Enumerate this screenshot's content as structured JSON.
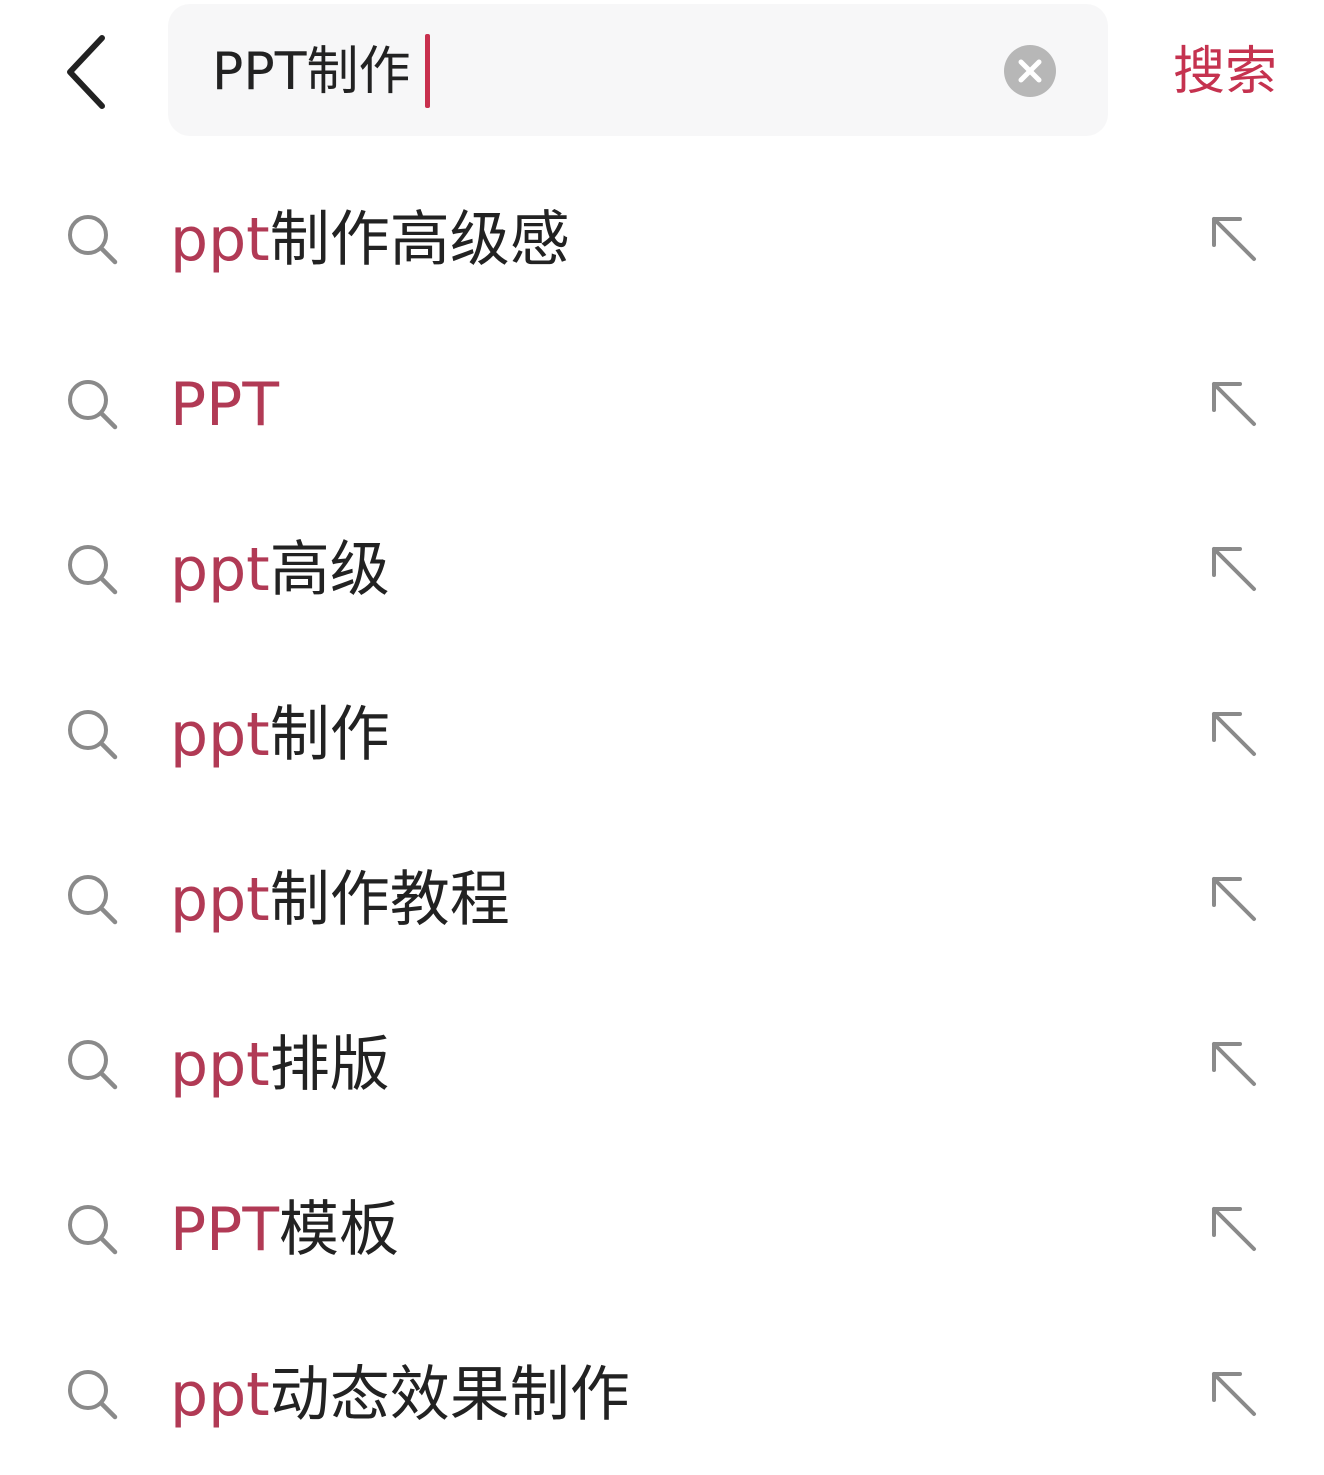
{
  "header": {
    "back_icon": "chevron-left-icon",
    "search_value": "PPT制作",
    "clear_icon": "clear-circle-icon",
    "search_button_label": "搜索"
  },
  "colors": {
    "accent": "#c5324f",
    "match_text": "#b13a55",
    "primary_text": "#222222",
    "icon_gray": "#8a8a8a",
    "search_bg": "#f7f7f8"
  },
  "suggestions": [
    {
      "match": "ppt",
      "rest": "制作高级感"
    },
    {
      "match": "PPT",
      "rest": ""
    },
    {
      "match": "ppt",
      "rest": "高级"
    },
    {
      "match": "ppt",
      "rest": "制作"
    },
    {
      "match": "ppt",
      "rest": "制作教程"
    },
    {
      "match": "ppt",
      "rest": "排版"
    },
    {
      "match": "PPT",
      "rest": "模板"
    },
    {
      "match": "ppt",
      "rest": "动态效果制作"
    }
  ],
  "suggestion_icons": {
    "leading": "search-icon",
    "trailing": "arrow-up-left-icon"
  }
}
